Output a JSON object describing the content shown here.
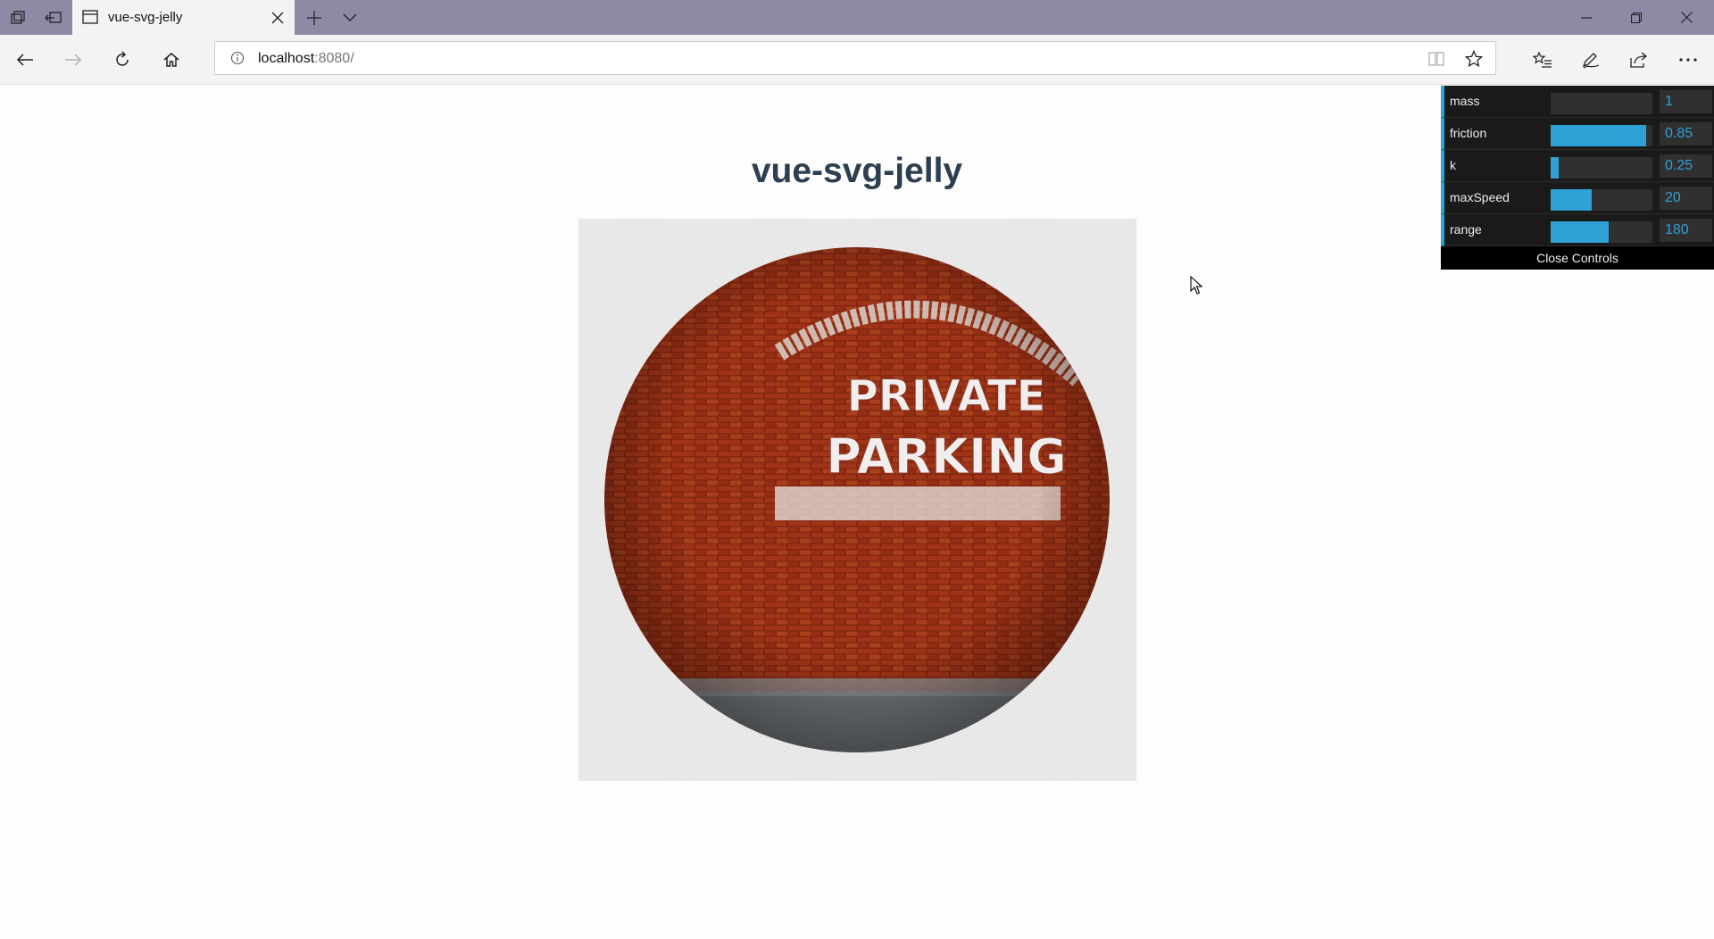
{
  "browser": {
    "tab_title": "vue-svg-jelly",
    "address_host": "localhost",
    "address_port": ":8080/"
  },
  "page": {
    "title": "vue-svg-jelly",
    "image_text": [
      "PRIVATE",
      "PARKING"
    ]
  },
  "controls": {
    "accent": "#2fa1d6",
    "rows": [
      {
        "label": "mass",
        "value": "1",
        "fill": 0.0
      },
      {
        "label": "friction",
        "value": "0.85",
        "fill": 0.94
      },
      {
        "label": "k",
        "value": "0.25",
        "fill": 0.08
      },
      {
        "label": "maxSpeed",
        "value": "20",
        "fill": 0.4
      },
      {
        "label": "range",
        "value": "180",
        "fill": 0.57
      }
    ],
    "close_label": "Close Controls"
  }
}
